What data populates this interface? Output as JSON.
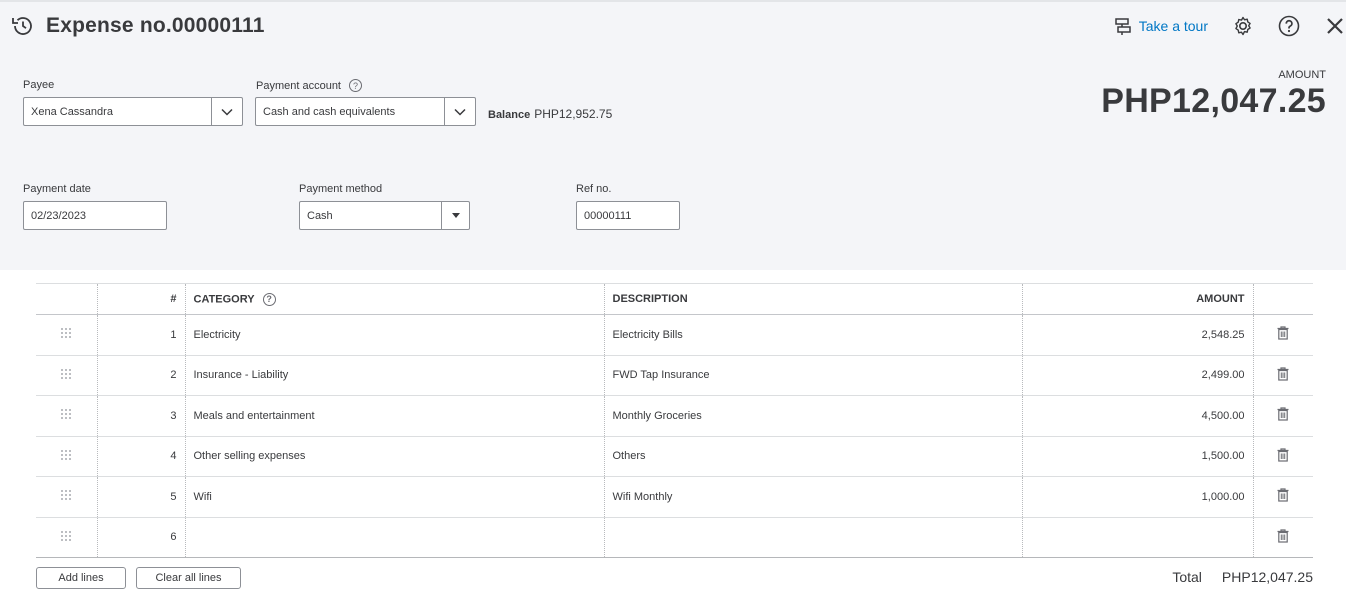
{
  "header": {
    "title": "Expense no.00000111",
    "take_tour": "Take a tour"
  },
  "form": {
    "payee": {
      "label": "Payee",
      "value": "Xena Cassandra"
    },
    "payment_account": {
      "label": "Payment account",
      "value": "Cash and cash equivalents"
    },
    "balance": {
      "label": "Balance",
      "value": "PHP12,952.75"
    },
    "payment_date": {
      "label": "Payment date",
      "value": "02/23/2023"
    },
    "payment_method": {
      "label": "Payment method",
      "value": "Cash"
    },
    "ref_no": {
      "label": "Ref no.",
      "value": "00000111"
    }
  },
  "amount": {
    "label": "AMOUNT",
    "value": "PHP12,047.25"
  },
  "table": {
    "headers": {
      "num": "#",
      "category": "CATEGORY",
      "description": "DESCRIPTION",
      "amount": "AMOUNT"
    },
    "rows": [
      {
        "num": "1",
        "category": "Electricity",
        "description": "Electricity Bills",
        "amount": "2,548.25"
      },
      {
        "num": "2",
        "category": "Insurance - Liability",
        "description": "FWD Tap Insurance",
        "amount": "2,499.00"
      },
      {
        "num": "3",
        "category": "Meals and entertainment",
        "description": "Monthly Groceries",
        "amount": "4,500.00"
      },
      {
        "num": "4",
        "category": "Other selling expenses",
        "description": "Others",
        "amount": "1,500.00"
      },
      {
        "num": "5",
        "category": "Wifi",
        "description": "Wifi Monthly",
        "amount": "1,000.00"
      },
      {
        "num": "6",
        "category": "",
        "description": "",
        "amount": ""
      }
    ]
  },
  "footer": {
    "add_lines": "Add lines",
    "clear_all_lines": "Clear all lines",
    "total_label": "Total",
    "total_value": "PHP12,047.25"
  },
  "icons": {
    "title": "recurring-clock-icon",
    "tour": "signpost-icon",
    "settings": "gear-icon",
    "help": "help-icon",
    "close": "close-icon",
    "drag": "drag-handle-icon",
    "delete": "trash-icon"
  },
  "colors": {
    "link": "#0077c5",
    "header_bg": "#f4f5f8"
  }
}
